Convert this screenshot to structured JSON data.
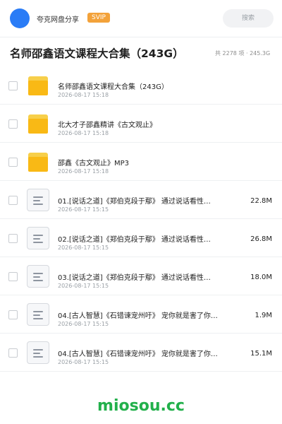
{
  "header": {
    "user_name": "夸克网盘分享",
    "vip_badge": "SVIP",
    "search_label": "搜索"
  },
  "page": {
    "title": "名师邵鑫语文课程大合集（243G）",
    "summary": "共 2278 项 · 245.3G"
  },
  "items": [
    {
      "type": "folder",
      "name": "名师邵鑫语文课程大合集（243G）",
      "date": "2026-08-17 15:18",
      "size": ""
    },
    {
      "type": "folder",
      "name": "北大才子邵鑫精讲《古文观止》",
      "date": "2026-08-17 15:18",
      "size": ""
    },
    {
      "type": "folder",
      "name": "邵鑫《古文观止》MP3",
      "date": "2026-08-17 15:18",
      "size": ""
    },
    {
      "type": "file",
      "name": "01.[说话之道]《郑伯克段于鄢》 通过说话看性…",
      "date": "2026-08-17 15:15",
      "size": "22.8M"
    },
    {
      "type": "file",
      "name": "02.[说话之道]《郑伯克段于鄢》 通过说话看性…",
      "date": "2026-08-17 15:15",
      "size": "26.8M"
    },
    {
      "type": "file",
      "name": "03.[说话之道]《郑伯克段于鄢》 通过说话看性…",
      "date": "2026-08-17 15:15",
      "size": "18.0M"
    },
    {
      "type": "file",
      "name": "04.[古人智慧]《石错谏宠州吁》 宠你就是害了你…",
      "date": "2026-08-17 15:15",
      "size": "1.9M"
    },
    {
      "type": "file",
      "name": "04.[古人智慧]《石错谏宠州吁》 宠你就是害了你…",
      "date": "2026-08-17 15:15",
      "size": "15.1M"
    }
  ],
  "footer": {
    "brand": "miosou.cc"
  },
  "colors": {
    "avatar": "#2a7cf6",
    "vip_badge": "#f3a23a",
    "folder": "#f9b915",
    "brand": "#22b04b"
  }
}
